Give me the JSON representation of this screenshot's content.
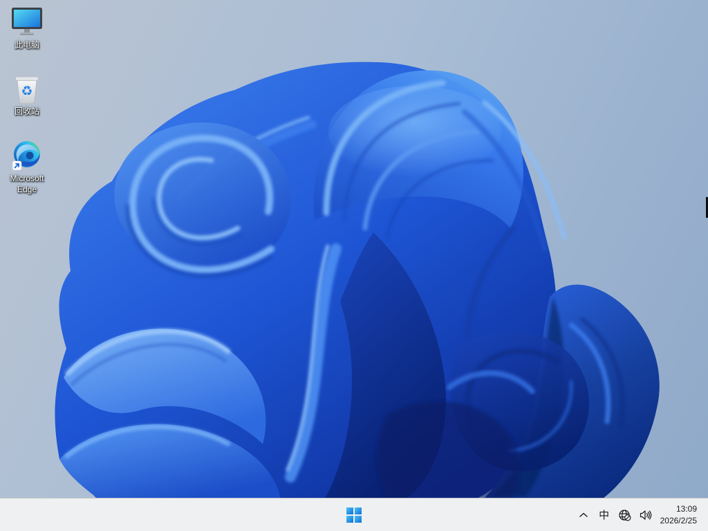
{
  "desktop": {
    "icons": [
      {
        "id": "this-pc",
        "icon": "this-pc-icon",
        "label": "此电脑"
      },
      {
        "id": "recycle-bin",
        "icon": "recycle-bin-icon",
        "label": "回收站"
      },
      {
        "id": "microsoft-edge",
        "icon": "edge-browser-icon",
        "label": "Microsoft Edge"
      }
    ]
  },
  "taskbar": {
    "start": {
      "icon": "windows-logo-icon"
    },
    "tray": {
      "chevron_icon": "chevron-up-icon",
      "ime_label": "中",
      "network_icon": "globe-no-internet-icon",
      "volume_icon": "speaker-icon",
      "clock": {
        "time": "13:09",
        "date": "2026/2/25"
      }
    }
  },
  "colors": {
    "wallpaper_sky_light": "#bac4d2",
    "wallpaper_sky_dark": "#8fa9c9",
    "bloom_highlight": "#7fb7f8",
    "bloom_blue": "#2563e3",
    "bloom_deep": "#0a2a7e",
    "taskbar_bg": "#eff0f1",
    "taskbar_border": "#c6c7c8",
    "start_blue_light": "#4cc3f7",
    "start_blue_dark": "#0f6fd8",
    "tray_foreground": "#1b1b1b"
  }
}
